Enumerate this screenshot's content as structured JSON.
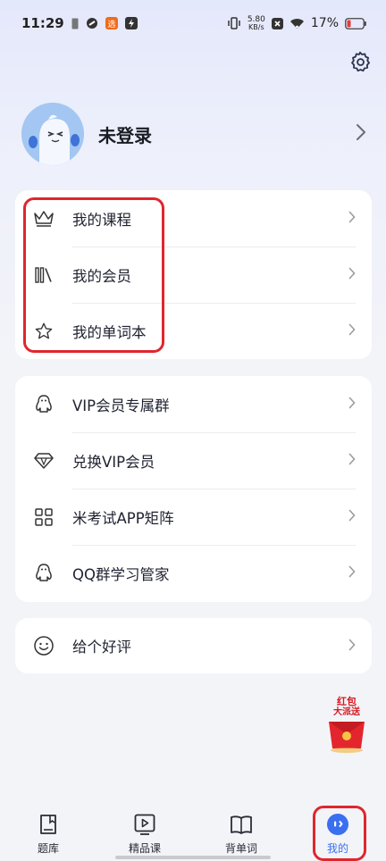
{
  "status_bar": {
    "time": "11:29",
    "net_speed_value": "5.80",
    "net_speed_unit": "KB/s",
    "battery_percent": "17%"
  },
  "profile": {
    "name": "未登录"
  },
  "menu_group_1": {
    "items": [
      {
        "icon": "crown-icon",
        "label": "我的课程"
      },
      {
        "icon": "books-icon",
        "label": "我的会员"
      },
      {
        "icon": "star-icon",
        "label": "我的单词本"
      }
    ]
  },
  "menu_group_2": {
    "items": [
      {
        "icon": "qq-penguin-icon",
        "label": "VIP会员专属群"
      },
      {
        "icon": "diamond-icon",
        "label": "兑换VIP会员"
      },
      {
        "icon": "app-grid-icon",
        "label": "米考试APP矩阵"
      },
      {
        "icon": "qq-penguin-icon",
        "label": "QQ群学习管家"
      }
    ]
  },
  "menu_group_3": {
    "items": [
      {
        "icon": "smile-icon",
        "label": "给个好评"
      }
    ]
  },
  "promo": {
    "line1": "红包",
    "line2": "大派送"
  },
  "bottom_nav": {
    "items": [
      {
        "icon": "question-bank-icon",
        "label": "题库",
        "active": false
      },
      {
        "icon": "video-course-icon",
        "label": "精品课",
        "active": false
      },
      {
        "icon": "open-book-icon",
        "label": "背单词",
        "active": false
      },
      {
        "icon": "mine-face-icon",
        "label": "我的",
        "active": true
      }
    ]
  },
  "colors": {
    "accent": "#3a6ff0",
    "annotation_red": "#e0262d",
    "card_bg": "#ffffff"
  }
}
